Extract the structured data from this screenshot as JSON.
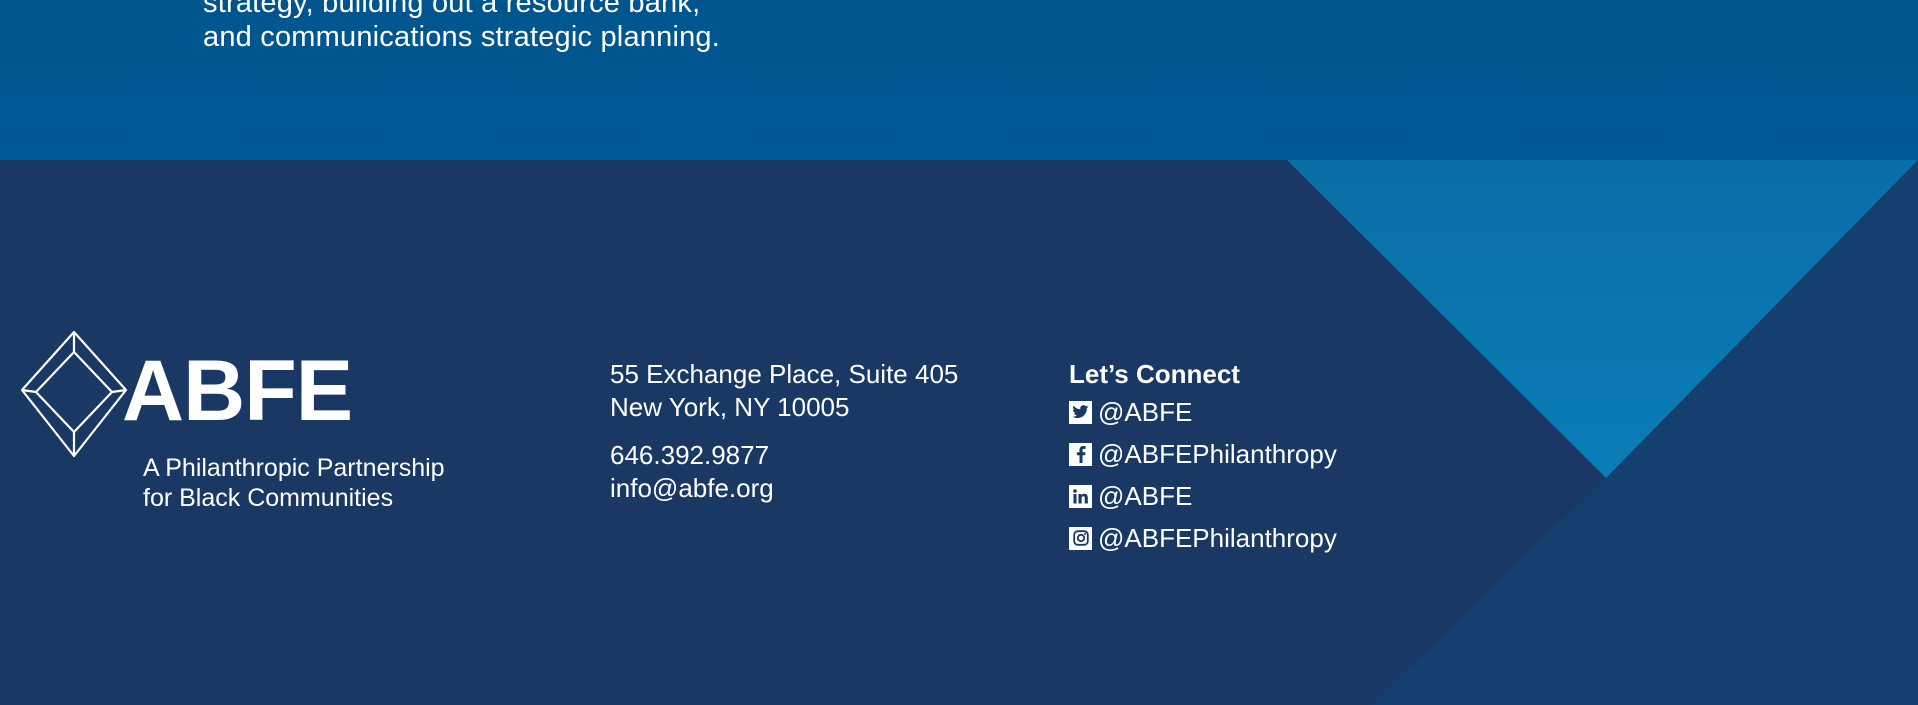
{
  "intro": {
    "line1": "strategy, building out a resource bank,",
    "line2": "and communications strategic planning."
  },
  "brand": {
    "wordmark": "ABFE",
    "tagline_line1": "A Philanthropic Partnership",
    "tagline_line2": "for Black Communities",
    "logo_icon": "diamond-cube-icon"
  },
  "contact": {
    "address_line1": "55 Exchange Place, Suite 405",
    "address_line2": "New York, NY 10005",
    "phone": "646.392.9877",
    "email": "info@abfe.org"
  },
  "connect": {
    "title": "Let’s Connect",
    "items": [
      {
        "icon": "twitter-icon",
        "handle": "@ABFE"
      },
      {
        "icon": "facebook-icon",
        "handle": "@ABFEPhilanthropy"
      },
      {
        "icon": "linkedin-icon",
        "handle": "@ABFE"
      },
      {
        "icon": "instagram-icon",
        "handle": "@ABFEPhilanthropy"
      }
    ]
  },
  "colors": {
    "top_band": "#00558e",
    "footer_bg": "#1a3864",
    "triangle_light": "#0a76b0",
    "triangle_dark": "#134070",
    "text": "#ffffff"
  }
}
